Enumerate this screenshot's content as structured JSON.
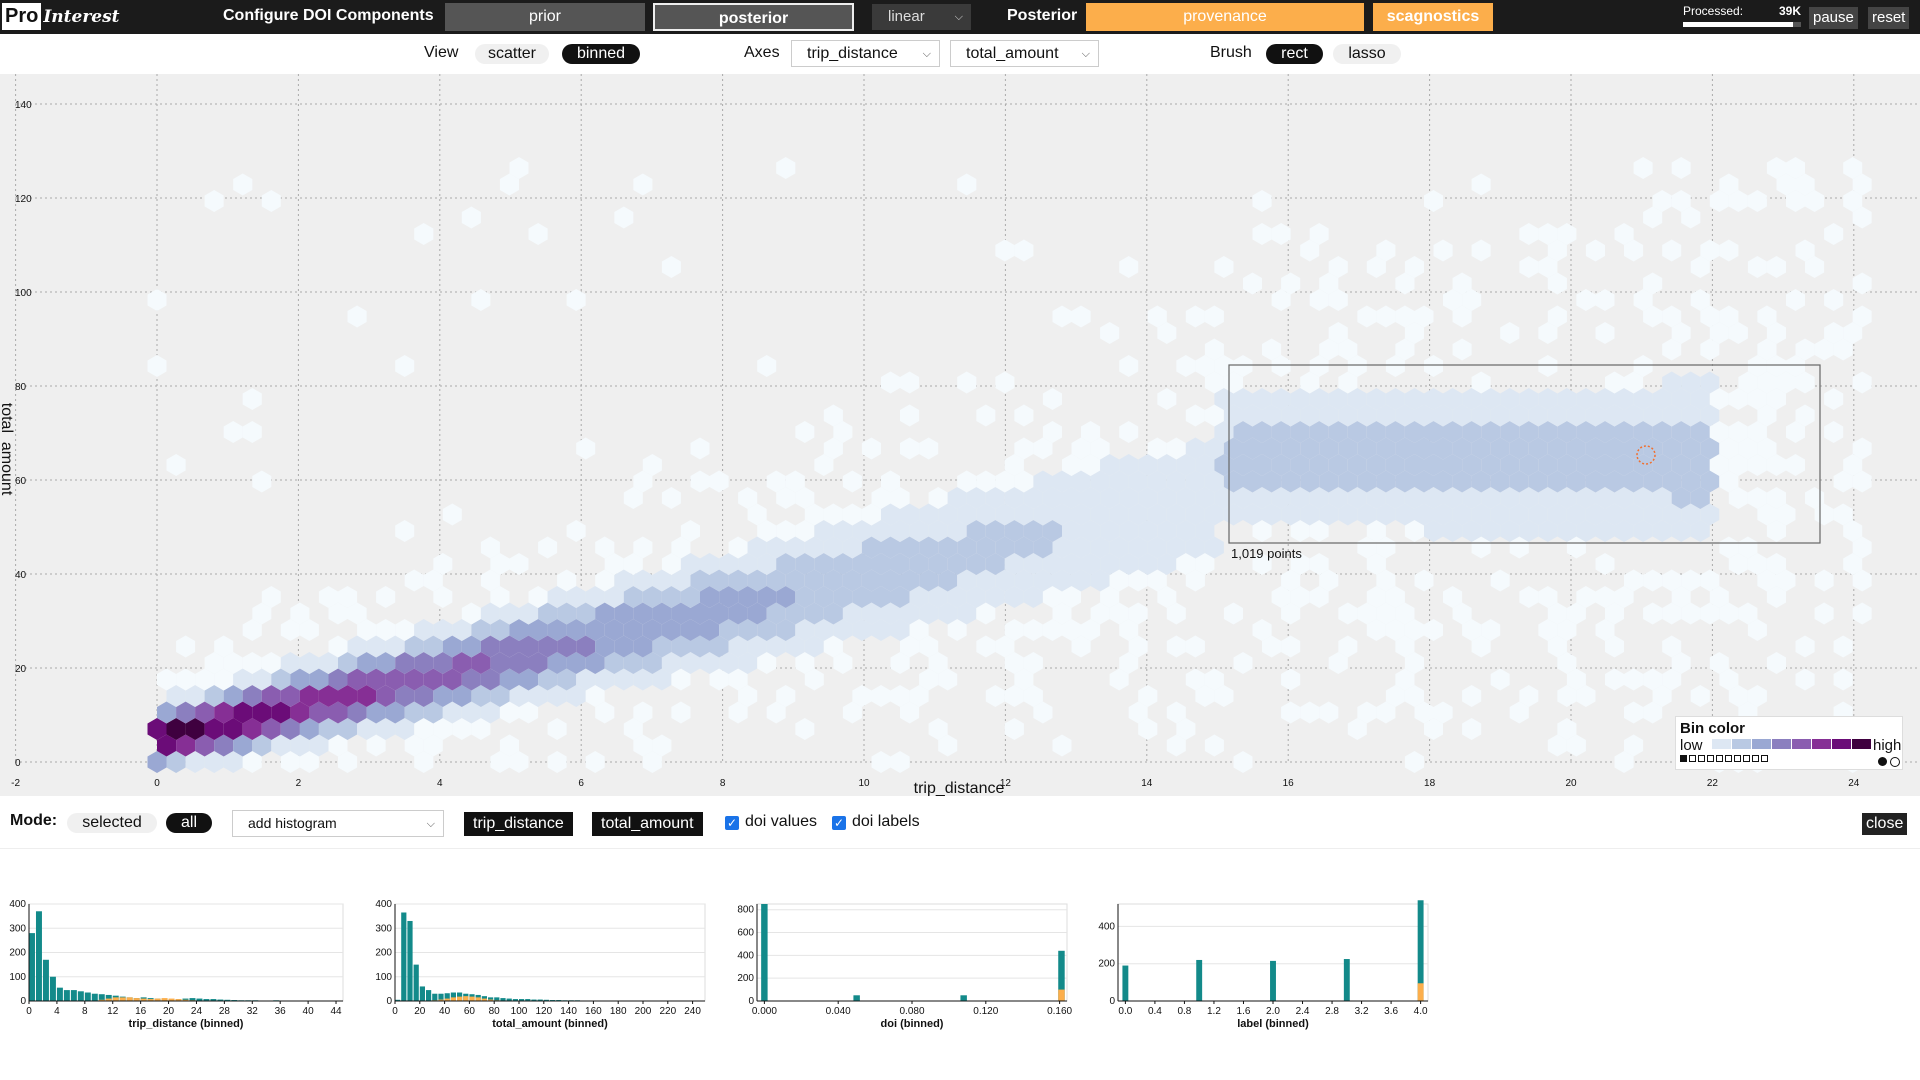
{
  "topbar": {
    "logo_pro": "Pro",
    "logo_interest": "Interest",
    "title": "Configure DOI Components",
    "prior_label": "prior",
    "posterior_label": "posterior",
    "scale_select": "linear",
    "posterior_heading": "Posterior",
    "provenance_label": "provenance",
    "scagnostics_label": "scagnostics",
    "processed_label": "Processed:",
    "processed_value": "39K",
    "processed_fraction": 0.93,
    "pause_label": "pause",
    "reset_label": "reset",
    "accent_color": "#fcae4b",
    "dark_button_color": "#555555"
  },
  "controls": {
    "view_label": "View",
    "view_options": [
      "scatter",
      "binned"
    ],
    "view_selected": "binned",
    "axes_label": "Axes",
    "x_axis": "trip_distance",
    "y_axis": "total_amount",
    "brush_label": "Brush",
    "brush_options": [
      "rect",
      "lasso"
    ],
    "brush_selected": "rect"
  },
  "scatter": {
    "xlabel": "trip_distance",
    "ylabel": "total_amount",
    "x_ticks": [
      "-2",
      "0",
      "2",
      "4",
      "6",
      "8",
      "10",
      "12",
      "14",
      "16",
      "18",
      "20",
      "22",
      "24"
    ],
    "y_ticks": [
      "0",
      "20",
      "40",
      "60",
      "80",
      "100",
      "120",
      "140"
    ],
    "brush_count": "1,019 points",
    "legend_title": "Bin color",
    "legend_low": "low",
    "legend_high": "high",
    "color_scale": [
      "#f5fafd",
      "#dde7f3",
      "#b9c9e3",
      "#9aa8d3",
      "#8b7fbf",
      "#8a5db0",
      "#862f95",
      "#6b0c78",
      "#3f003f"
    ]
  },
  "bottom": {
    "mode_label": "Mode:",
    "mode_options": [
      "selected",
      "all"
    ],
    "mode_selected": "all",
    "add_histogram": "add histogram",
    "field_tags": [
      "trip_distance",
      "total_amount"
    ],
    "doi_values_label": "doi values",
    "doi_labels_label": "doi labels",
    "doi_values_checked": true,
    "doi_labels_checked": true,
    "close_label": "close"
  },
  "chart_data": [
    {
      "type": "bar",
      "title": "",
      "xlabel": "trip_distance (binned)",
      "x_ticks": [
        "0",
        "4",
        "8",
        "12",
        "16",
        "20",
        "24",
        "28",
        "32",
        "36",
        "40",
        "44"
      ],
      "y_ticks": [
        "0",
        "100",
        "200",
        "300",
        "400"
      ],
      "ylim": [
        0,
        400
      ],
      "xlim": [
        0,
        45
      ],
      "bin_width": 1,
      "series": [
        {
          "values": [
            280,
            370,
            170,
            100,
            55,
            45,
            45,
            40,
            35,
            30,
            28,
            25,
            22,
            18,
            15,
            12,
            15,
            12,
            10,
            10,
            8,
            8,
            10,
            12,
            10,
            8,
            8,
            6,
            5,
            4,
            3,
            3,
            3,
            2,
            2,
            3,
            2,
            2,
            2,
            2,
            1,
            1,
            1,
            1,
            1
          ]
        },
        {
          "values": [
            0,
            0,
            0,
            0,
            0,
            0,
            0,
            0,
            0,
            2,
            5,
            10,
            15,
            15,
            15,
            12,
            10,
            8,
            10,
            12,
            10,
            8,
            5,
            3,
            2,
            1,
            0,
            0,
            0,
            0,
            0,
            0,
            0,
            0,
            0,
            0,
            0,
            0,
            0,
            0,
            0,
            0,
            0,
            0,
            0
          ]
        }
      ]
    },
    {
      "type": "bar",
      "title": "",
      "xlabel": "total_amount (binned)",
      "x_ticks": [
        "0",
        "20",
        "40",
        "60",
        "80",
        "100",
        "120",
        "140",
        "160",
        "180",
        "200",
        "220",
        "240"
      ],
      "y_ticks": [
        "0",
        "100",
        "200",
        "300",
        "400"
      ],
      "ylim": [
        0,
        400
      ],
      "xlim": [
        0,
        250
      ],
      "bin_width": 5,
      "series": [
        {
          "values": [
            5,
            365,
            330,
            150,
            60,
            45,
            30,
            30,
            32,
            35,
            35,
            30,
            28,
            25,
            20,
            15,
            15,
            12,
            10,
            8,
            8,
            8,
            6,
            6,
            5,
            4,
            4,
            3,
            3,
            3,
            2,
            2,
            2,
            2,
            2,
            2,
            1,
            1,
            1,
            1,
            1,
            1,
            1,
            1,
            1,
            1,
            1,
            1,
            1,
            1
          ]
        },
        {
          "values": [
            0,
            0,
            0,
            0,
            0,
            0,
            3,
            6,
            10,
            15,
            18,
            20,
            18,
            15,
            10,
            6,
            3,
            2,
            1,
            0,
            0,
            0,
            0,
            0,
            0,
            0,
            0,
            0,
            0,
            0,
            0,
            0,
            0,
            0,
            0,
            0,
            0,
            0,
            0,
            0,
            0,
            0,
            0,
            0,
            0,
            0,
            0,
            0,
            0,
            0
          ]
        }
      ]
    },
    {
      "type": "bar",
      "title": "",
      "xlabel": "doi (binned)",
      "x_ticks": [
        "0.000",
        "0.040",
        "0.080",
        "0.120",
        "0.160"
      ],
      "x_tick_values": [
        0,
        0.04,
        0.08,
        0.12,
        0.16
      ],
      "y_ticks": [
        "0",
        "200",
        "400",
        "600",
        "800"
      ],
      "ylim": [
        0,
        850
      ],
      "xlim": [
        -0.004,
        0.164
      ],
      "bar_width": 0.0035,
      "series": [
        {
          "x": [
            0.0,
            0.05,
            0.108,
            0.161
          ],
          "values": [
            850,
            50,
            50,
            440
          ]
        },
        {
          "x": [
            0.0,
            0.05,
            0.108,
            0.161
          ],
          "values": [
            0,
            0,
            0,
            100
          ]
        }
      ]
    },
    {
      "type": "bar",
      "title": "",
      "xlabel": "label (binned)",
      "x_ticks": [
        "0.0",
        "0.4",
        "0.8",
        "1.2",
        "1.6",
        "2.0",
        "2.4",
        "2.8",
        "3.2",
        "3.6",
        "4.0"
      ],
      "x_tick_values": [
        0,
        0.4,
        0.8,
        1.2,
        1.6,
        2.0,
        2.4,
        2.8,
        3.2,
        3.6,
        4.0
      ],
      "y_ticks": [
        "0",
        "200",
        "400"
      ],
      "ylim": [
        0,
        520
      ],
      "xlim": [
        -0.1,
        4.1
      ],
      "bar_width": 0.08,
      "series": [
        {
          "x": [
            0,
            1,
            2,
            3,
            4
          ],
          "values": [
            190,
            220,
            215,
            225,
            540
          ]
        },
        {
          "x": [
            0,
            1,
            2,
            3,
            4
          ],
          "values": [
            0,
            0,
            0,
            0,
            95
          ]
        }
      ]
    }
  ]
}
